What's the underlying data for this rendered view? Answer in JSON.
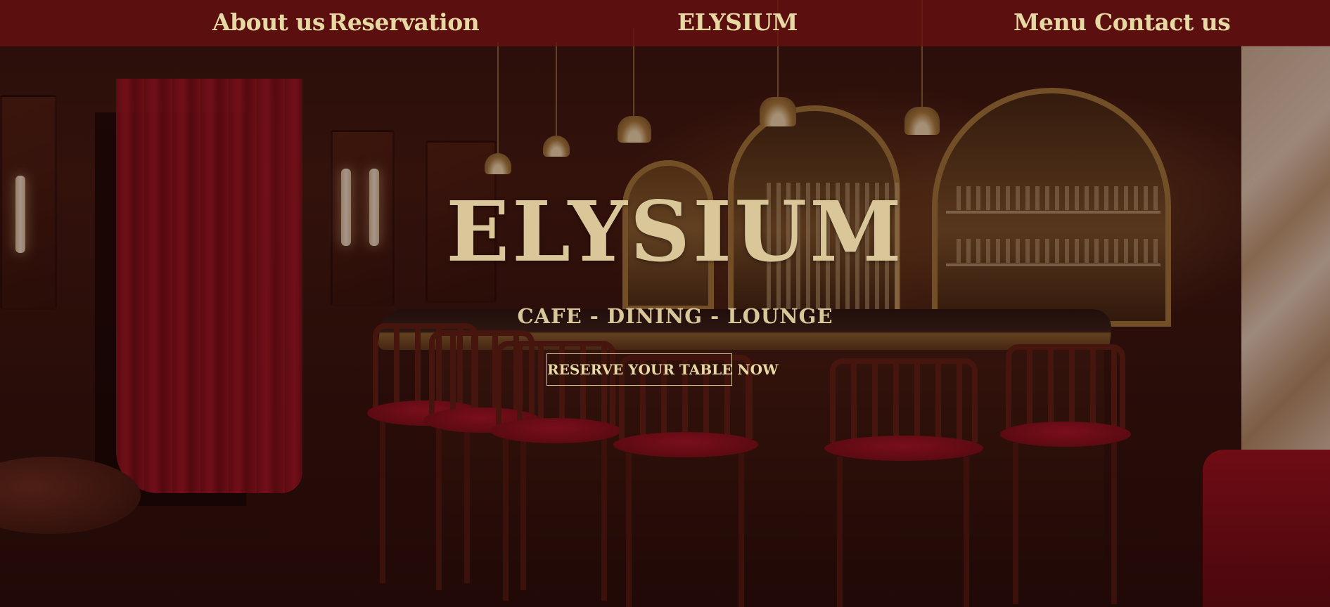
{
  "nav": {
    "about_label": "About us",
    "reservation_label": "Reservation",
    "brand": "ELYSIUM",
    "menu_label": "Menu",
    "contact_label": "Contact us"
  },
  "hero": {
    "title": "ELYSIUM",
    "subtitle": "CAFE - DINING - LOUNGE",
    "cta_label": "RESERVE YOUR TABLE NOW"
  },
  "colors": {
    "nav_background": "#691010",
    "gold_text": "#e7d9a3",
    "logo_gold": "#d9c79a"
  }
}
